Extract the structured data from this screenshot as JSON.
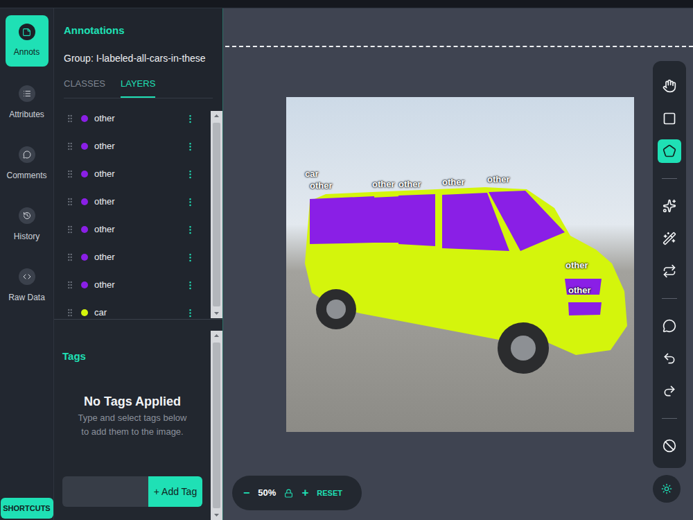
{
  "sidebar": {
    "items": [
      {
        "label": "Annots",
        "selected": true
      },
      {
        "label": "Attributes",
        "selected": false
      },
      {
        "label": "Comments",
        "selected": false
      },
      {
        "label": "History",
        "selected": false
      },
      {
        "label": "Raw Data",
        "selected": false
      }
    ],
    "shortcuts": "SHORTCUTS"
  },
  "annotations": {
    "title": "Annotations",
    "group": "Group: I-labeled-all-cars-in-these",
    "tabs": [
      {
        "label": "CLASSES",
        "selected": false
      },
      {
        "label": "LAYERS",
        "selected": true
      }
    ],
    "layers": [
      {
        "label": "other",
        "color": "#8a1fe6"
      },
      {
        "label": "other",
        "color": "#8a1fe6"
      },
      {
        "label": "other",
        "color": "#8a1fe6"
      },
      {
        "label": "other",
        "color": "#8a1fe6"
      },
      {
        "label": "other",
        "color": "#8a1fe6"
      },
      {
        "label": "other",
        "color": "#8a1fe6"
      },
      {
        "label": "other",
        "color": "#8a1fe6"
      },
      {
        "label": "car",
        "color": "#d4f50c"
      }
    ]
  },
  "tags": {
    "title": "Tags",
    "empty_title": "No Tags Applied",
    "empty_hint": "Type and select tags below to add them to the image.",
    "add_button": "+ Add Tag"
  },
  "toolbar": {
    "groups": [
      [
        {
          "kind": "pan",
          "selected": false
        },
        {
          "kind": "box",
          "selected": false
        },
        {
          "kind": "polygon",
          "selected": true
        }
      ],
      [
        {
          "kind": "smart",
          "selected": false
        },
        {
          "kind": "wand",
          "selected": false
        },
        {
          "kind": "repeat",
          "selected": false
        }
      ],
      [
        {
          "kind": "comment",
          "selected": false
        },
        {
          "kind": "undo",
          "selected": false
        },
        {
          "kind": "redo",
          "selected": false
        }
      ],
      [
        {
          "kind": "null",
          "selected": false
        }
      ]
    ]
  },
  "zoom": {
    "minus": "−",
    "value": "50%",
    "plus": "+",
    "reset": "RESET"
  }
}
